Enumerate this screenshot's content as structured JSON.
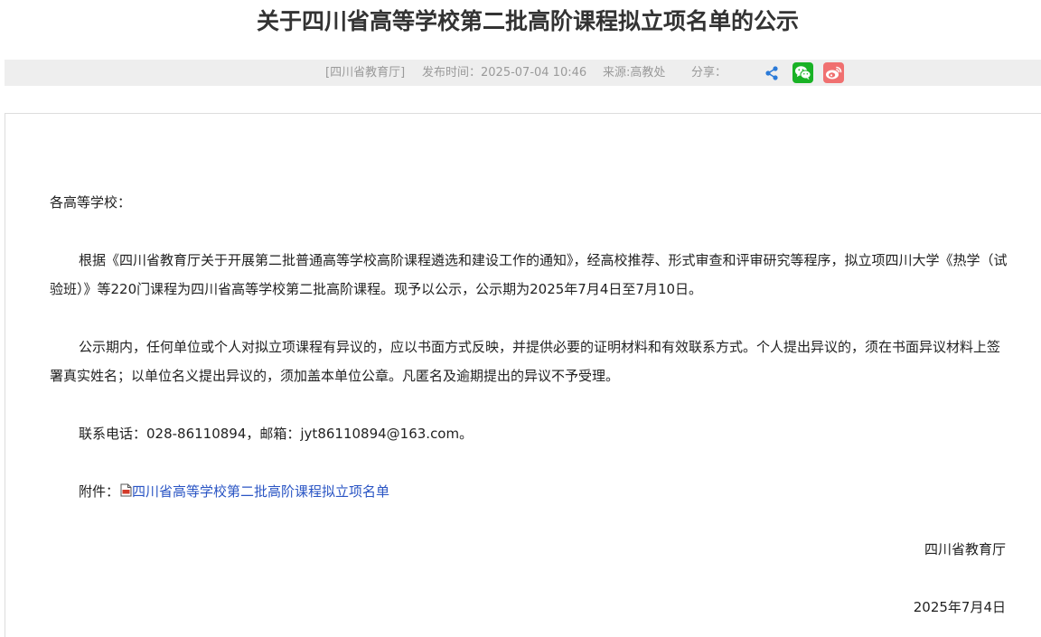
{
  "article": {
    "title": "关于四川省高等学校第二批高阶课程拟立项名单的公示"
  },
  "meta": {
    "publisher": "[四川省教育厅]",
    "publish_time": "发布时间：2025-07-04 10:46",
    "source": "来源:高教处",
    "share_label": "分享："
  },
  "share": {
    "icons": [
      "share-icon",
      "wechat-icon",
      "weibo-icon"
    ],
    "colors": {
      "wechat": "#19b225",
      "weibo": "#f07070",
      "generic": "#2a7ad8"
    }
  },
  "body": {
    "greeting": "各高等学校：",
    "paragraph1": "根据《四川省教育厅关于开展第二批普通高等学校高阶课程遴选和建设工作的通知》，经高校推荐、形式审查和评审研究等程序，拟立项四川大学《热学（试验班）》等220门课程为四川省高等学校第二批高阶课程。现予以公示，公示期为2025年7月4日至7月10日。",
    "paragraph2": "公示期内，任何单位或个人对拟立项课程有异议的，应以书面方式反映，并提供必要的证明材料和有效联系方式。个人提出异议的，须在书面异议材料上签署真实姓名；以单位名义提出异议的，须加盖本单位公章。凡匿名及逾期提出的异议不予受理。",
    "contact": "联系电话：028-86110894，邮箱：jyt86110894@163.com。",
    "attachment_label": "附件：",
    "attachment_link": "四川省高等学校第二批高阶课程拟立项名单",
    "signature_org": "四川省教育厅",
    "signature_date": "2025年7月4日"
  }
}
